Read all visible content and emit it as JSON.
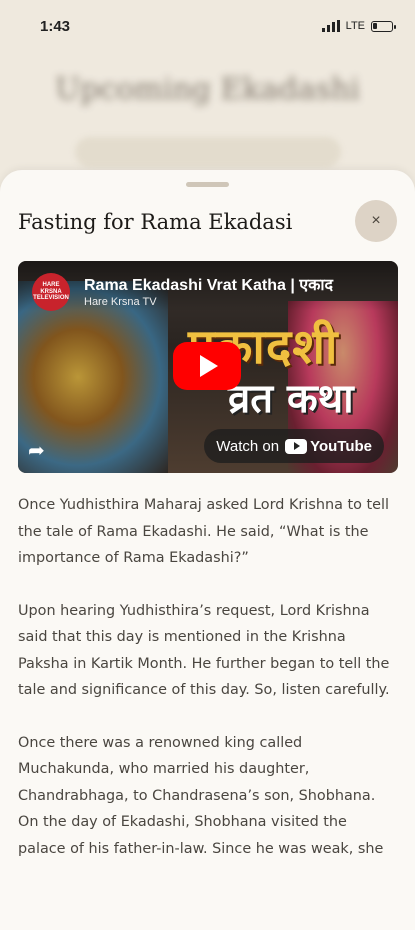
{
  "status_bar": {
    "time": "1:43",
    "network": "LTE"
  },
  "background_page": {
    "title": "Upcoming Ekadashi"
  },
  "sheet": {
    "title": "Fasting for Rama Ekadasi",
    "close_icon": "×"
  },
  "video": {
    "title": "Rama Ekadashi Vrat Katha | एकाद",
    "channel": "Hare Krsna TV",
    "channel_logo_text": "HARE KRSNA TELEVISION",
    "thumbnail_text_1": "एकादशी",
    "thumbnail_text_2": "व्रत कथा",
    "watch_on": "Watch on",
    "youtube": "YouTube"
  },
  "content": {
    "paragraphs": [
      "Once Yudhisthira Maharaj asked Lord Krishna to tell the tale of Rama Ekadashi. He said, “What is the importance of Rama Ekadashi?”",
      "Upon hearing Yudhisthira’s request, Lord Krishna said that this day is mentioned in the Krishna Paksha in Kartik Month. He further began to tell the tale and significance of this day. So, listen carefully.",
      "Once there was a renowned king called Muchakunda, who married his daughter, Chandrabhaga, to Chandrasena’s son, Shobhana. On the day of Ekadashi, Shobhana visited the palace of his father-in-law. Since he was weak, she"
    ]
  }
}
